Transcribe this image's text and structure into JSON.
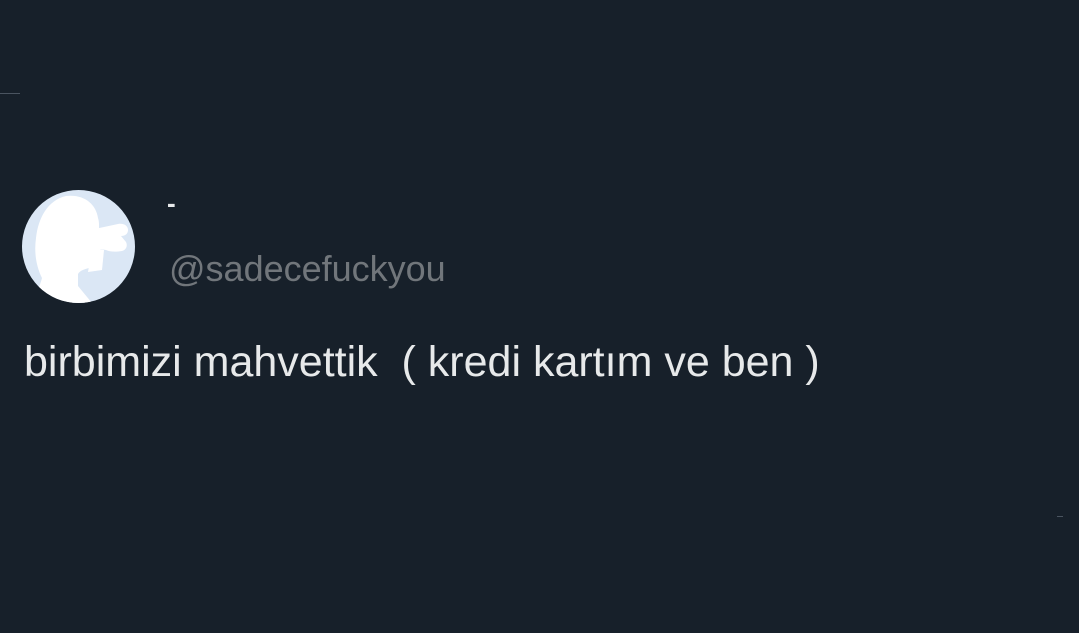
{
  "tweet": {
    "author": {
      "display_name": "-",
      "handle": "@sadecefuckyou",
      "avatar_icon": "default-profile-silhouette-icon"
    },
    "text": "birbimizi mahvettik  ( kredi kartım ve ben )"
  },
  "colors": {
    "background": "#17202a",
    "primary_text": "#e7e9ea",
    "secondary_text": "#71767b",
    "avatar_background": "#dbe7f5",
    "avatar_silhouette": "#ffffff"
  }
}
